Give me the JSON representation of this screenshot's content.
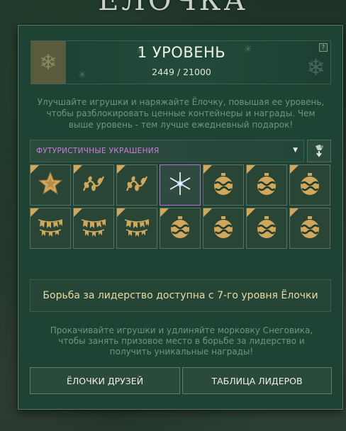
{
  "window": {
    "title": "ЁЛОЧКА"
  },
  "level": {
    "title": "1 УРОВЕНЬ",
    "progress": "2449 / 21000",
    "help": "?",
    "progress_current": 2449,
    "progress_max": 21000
  },
  "description": "Улучшайте игрушки и наряжайте Ёлочку, повышая ее уровень, чтобы разблокировать ценные контейнеры и награды. Чем выше уровень - тем лучше ежедневный подарок!",
  "category": {
    "selected": "ФУТУРИСТИЧНЫЕ УКРАШЕНИЯ",
    "accent_color": "#c77ddb",
    "dropdown_icon": "triangle-down-icon",
    "action_icon": "hand-drop-icon"
  },
  "slots": [
    {
      "type": "star",
      "corner": true,
      "selected": false
    },
    {
      "type": "garland",
      "corner": true,
      "selected": false
    },
    {
      "type": "garland",
      "corner": true,
      "selected": false
    },
    {
      "type": "sparkle",
      "corner": false,
      "selected": true
    },
    {
      "type": "ball",
      "corner": true,
      "selected": false
    },
    {
      "type": "ball",
      "corner": true,
      "selected": false
    },
    {
      "type": "ball",
      "corner": true,
      "selected": false
    },
    {
      "type": "flags",
      "corner": true,
      "selected": false
    },
    {
      "type": "flags",
      "corner": true,
      "selected": false
    },
    {
      "type": "flags",
      "corner": true,
      "selected": false
    },
    {
      "type": "ball",
      "corner": true,
      "selected": false
    },
    {
      "type": "ball",
      "corner": true,
      "selected": false
    },
    {
      "type": "ball",
      "corner": true,
      "selected": false
    },
    {
      "type": "ball",
      "corner": true,
      "selected": false
    }
  ],
  "notice": "Борьба за лидерство доступна с 7-го уровня Ёлочки",
  "note": "Прокачивайте игрушки и удлиняйте морковку Снеговика, чтобы занять призовое место в борьбе за лидерство и получить уникальные награды!",
  "buttons": {
    "friends": "ЁЛОЧКИ ДРУЗЕЙ",
    "leaders": "ТАБЛИЦА ЛИДЕРОВ"
  },
  "colors": {
    "gold": "#d1a75c",
    "panel": "#1e4234",
    "text_muted": "#6f977c",
    "notice_text": "#ebd9a2"
  }
}
